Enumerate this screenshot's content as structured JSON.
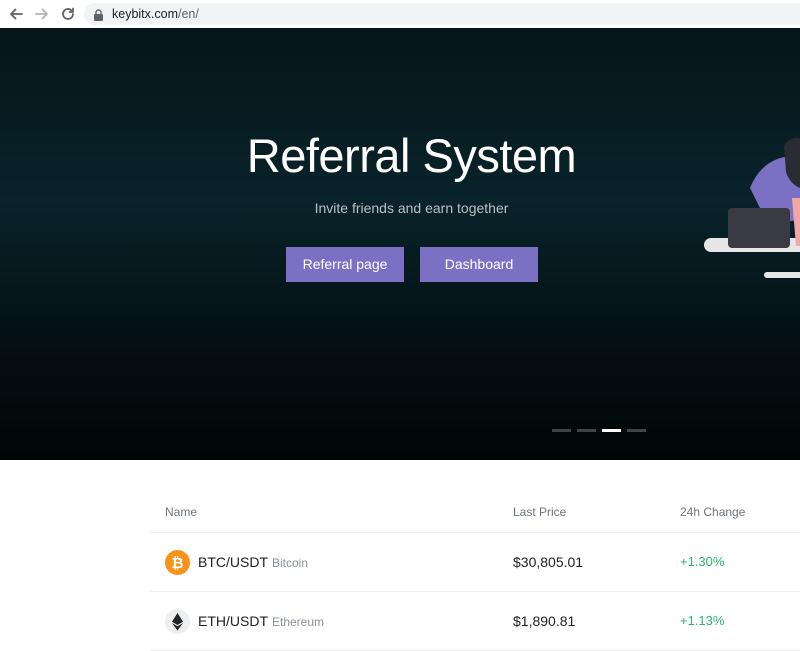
{
  "browser": {
    "url_domain": "keybitx.com",
    "url_path": "/en/"
  },
  "hero": {
    "title": "Referral System",
    "subtitle": "Invite friends and earn together",
    "buttons": {
      "referral": "Referral page",
      "dashboard": "Dashboard"
    },
    "carousel": {
      "slides": 4,
      "active": 3
    }
  },
  "market": {
    "headers": {
      "name": "Name",
      "price": "Last Price",
      "change": "24h Change"
    },
    "rows": [
      {
        "pair": "BTC/USDT",
        "name": "Bitcoin",
        "price": "$30,805.01",
        "change": "+1.30%",
        "icon": "bitcoin-icon"
      },
      {
        "pair": "ETH/USDT",
        "name": "Ethereum",
        "price": "$1,890.81",
        "change": "+1.13%",
        "icon": "ethereum-icon"
      }
    ]
  },
  "colors": {
    "accent": "#7b70c4",
    "positive": "#2fb36b",
    "bitcoin": "#f7931a"
  }
}
